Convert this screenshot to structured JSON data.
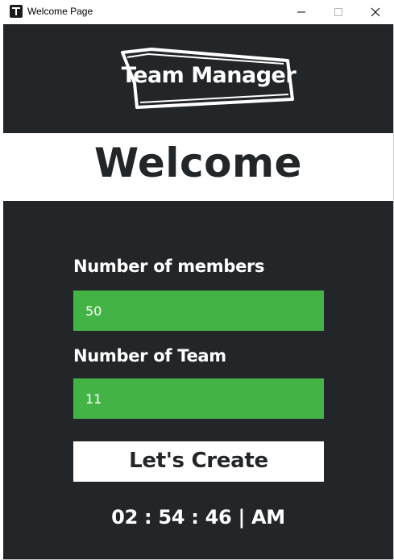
{
  "window": {
    "title": "Welcome Page",
    "controls": {
      "minimize": "minimize-icon",
      "maximize": "maximize-icon",
      "close": "close-icon"
    }
  },
  "logo": {
    "text": "Team Manager"
  },
  "welcome": {
    "heading": "Welcome"
  },
  "form": {
    "members_label": "Number of members",
    "members_value": "50",
    "team_label": "Number of Team",
    "team_value": "11",
    "submit_label": "Let's Create"
  },
  "clock": {
    "text": "02 : 54 : 46 | AM"
  },
  "colors": {
    "background": "#222628",
    "field": "#43b346",
    "banner": "#ffffff",
    "text_light": "#ffffff",
    "text_dark": "#222628"
  }
}
